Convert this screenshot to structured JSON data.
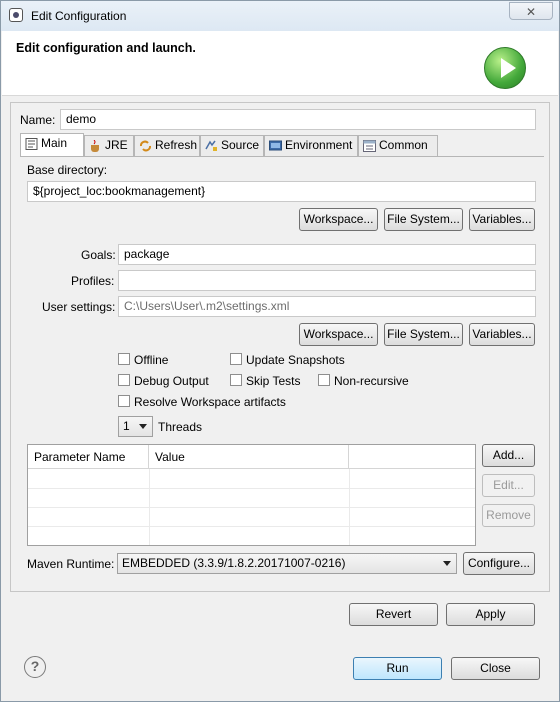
{
  "window": {
    "title": "Edit Configuration",
    "close_glyph": "✕"
  },
  "header": {
    "title": "Edit configuration and launch."
  },
  "name_field": {
    "label": "Name:",
    "value": "demo"
  },
  "tabs": [
    {
      "label": "Main",
      "icon": "main-icon"
    },
    {
      "label": "JRE",
      "icon": "jre-icon"
    },
    {
      "label": "Refresh",
      "icon": "refresh-icon"
    },
    {
      "label": "Source",
      "icon": "source-icon"
    },
    {
      "label": "Environment",
      "icon": "environment-icon"
    },
    {
      "label": "Common",
      "icon": "common-icon"
    }
  ],
  "main": {
    "base_dir_label": "Base directory:",
    "base_dir_value": "${project_loc:bookmanagement}",
    "buttons": {
      "workspace": "Workspace...",
      "file_system": "File System...",
      "variables": "Variables..."
    },
    "goals_label": "Goals:",
    "goals_value": "package",
    "profiles_label": "Profiles:",
    "profiles_value": "",
    "user_settings_label": "User settings:",
    "user_settings_value": "C:\\Users\\User\\.m2\\settings.xml",
    "checkboxes": {
      "offline": "Offline",
      "update_snapshots": "Update Snapshots",
      "debug_output": "Debug Output",
      "skip_tests": "Skip Tests",
      "non_recursive": "Non-recursive",
      "resolve_workspace": "Resolve Workspace artifacts"
    },
    "threads_value": "1",
    "threads_label": "Threads",
    "table": {
      "col_name": "Parameter Name",
      "col_value": "Value",
      "add": "Add...",
      "edit": "Edit...",
      "remove": "Remove"
    },
    "runtime_label": "Maven Runtime:",
    "runtime_value": "EMBEDDED (3.3.9/1.8.2.20171007-0216)",
    "configure": "Configure..."
  },
  "footer": {
    "revert": "Revert",
    "apply": "Apply",
    "run": "Run",
    "close": "Close",
    "help": "?"
  }
}
